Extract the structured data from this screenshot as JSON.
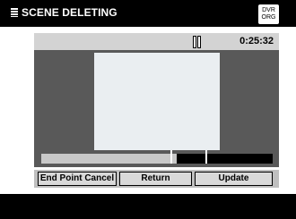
{
  "header": {
    "title": "SCENE DELETING",
    "badge_line1": "DVR",
    "badge_line2": "ORG"
  },
  "player": {
    "time": "0:25:32",
    "state_icon": "pause-icon",
    "progress": 0.585,
    "markers": [
      0.56,
      0.71
    ]
  },
  "buttons": {
    "end_point_cancel": "End Point Cancel",
    "return": "Return",
    "update": "Update"
  }
}
